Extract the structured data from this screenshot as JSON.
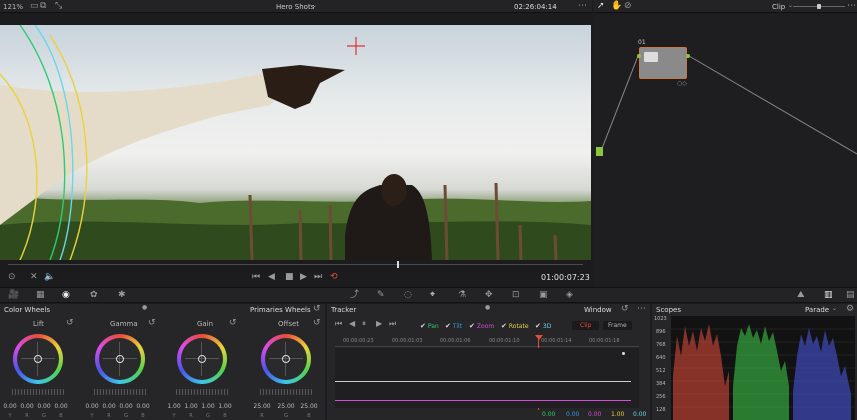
{
  "viewer": {
    "zoom": "121%",
    "title": "Hero Shots",
    "timecode_top": "02:26:04:14",
    "timecode_bottom": "01:00:07:23"
  },
  "nodes": {
    "mode": "Clip",
    "node_label": "01"
  },
  "color_wheels": {
    "title": "Color Wheels",
    "mode": "Primaries Wheels",
    "wheels": [
      {
        "name": "Lift",
        "values": [
          "0.00",
          "0.00",
          "0.00",
          "0.00"
        ]
      },
      {
        "name": "Gamma",
        "values": [
          "0.00",
          "0.00",
          "0.00",
          "0.00"
        ]
      },
      {
        "name": "Gain",
        "values": [
          "1.00",
          "1.00",
          "1.00",
          "1.00"
        ]
      },
      {
        "name": "Offset",
        "values": [
          "25.00",
          "25.00",
          "25.00"
        ]
      }
    ],
    "channel_labels": [
      "Y",
      "R",
      "G",
      "B"
    ]
  },
  "tracker": {
    "title": "Tracker",
    "mode": "Window",
    "options": [
      "Pan",
      "Tilt",
      "Zoom",
      "Rotate",
      "3D"
    ],
    "clip_label": "Clip",
    "frame_label": "Frame",
    "ruler": [
      "00:00:00:23",
      "00:00:01:03",
      "00:00:01:06",
      "00:00:01:10",
      "00:00:01:14",
      "00:00:01:18"
    ],
    "values": [
      "0.00",
      "0.00",
      "0.00",
      "1.00",
      "0.00"
    ]
  },
  "scopes": {
    "title": "Scopes",
    "mode": "Parade",
    "ticks": [
      "1023",
      "896",
      "768",
      "640",
      "512",
      "384",
      "256",
      "128"
    ]
  },
  "colors": {
    "accent": "#e84c3d",
    "pan": "#2ecc71",
    "tilt": "#3498db",
    "zoom": "#d64dd6",
    "rotate": "#e8d23c",
    "threed": "#6ad6e8"
  }
}
